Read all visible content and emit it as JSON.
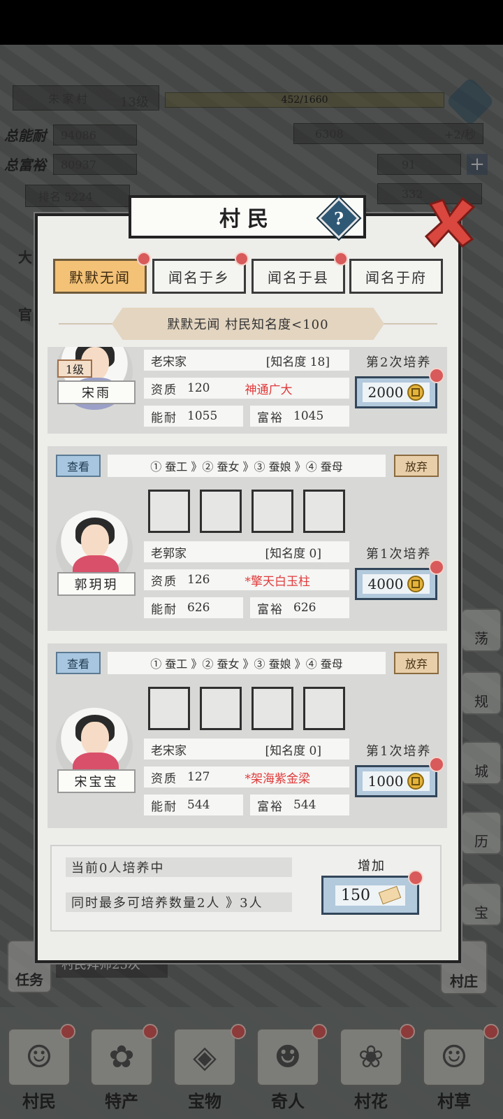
{
  "hud": {
    "village_name": "朱家村",
    "village_level": "13级",
    "exp_text": "452/1660",
    "total_power_label": "总能耐",
    "total_power_value": "94086",
    "total_wealth_label": "总富裕",
    "total_wealth_value": "80937",
    "rank_text": "排名 5224",
    "coins": "6308",
    "coin_rate": "+2/秒",
    "ingots": "91",
    "tickets": "332"
  },
  "panel": {
    "title": "村民",
    "help_label": "?",
    "tabs": [
      {
        "label": "默默无闻",
        "active": true
      },
      {
        "label": "闻名于乡",
        "active": false
      },
      {
        "label": "闻名于县",
        "active": false
      },
      {
        "label": "闻名于府",
        "active": false
      }
    ],
    "banner": "默默无闻   村民知名度<100"
  },
  "villagers": [
    {
      "level": "1级",
      "name": "宋雨",
      "family": "老宋家",
      "fame": "[知名度 18]",
      "aptitude_label": "资质",
      "aptitude_value": "120",
      "aptitude_title": "神通广大",
      "power_label": "能耐",
      "power_value": "1055",
      "wealth_label": "富裕",
      "wealth_value": "1045",
      "train_label": "第2次培养",
      "cost": "2000"
    },
    {
      "view_label": "查看",
      "drop_label": "放弃",
      "path": "① 蚕工 》② 蚕女 》③ 蚕娘 》④ 蚕母",
      "name": "郭玥玥",
      "family": "老郭家",
      "fame": "[知名度 0]",
      "aptitude_label": "资质",
      "aptitude_value": "126",
      "aptitude_title": "*擎天白玉柱",
      "power_label": "能耐",
      "power_value": "626",
      "wealth_label": "富裕",
      "wealth_value": "626",
      "train_label": "第1次培养",
      "cost": "4000"
    },
    {
      "view_label": "查看",
      "drop_label": "放弃",
      "path": "① 蚕工 》② 蚕女 》③ 蚕娘 》④ 蚕母",
      "name": "宋宝宝",
      "family": "老宋家",
      "fame": "[知名度 0]",
      "aptitude_label": "资质",
      "aptitude_value": "127",
      "aptitude_title": "*架海紫金梁",
      "power_label": "能耐",
      "power_value": "544",
      "wealth_label": "富裕",
      "wealth_value": "544",
      "train_label": "第1次培养",
      "cost": "1000"
    }
  ],
  "footer": {
    "current_training": "当前0人培养中",
    "max_training": "同时最多可培养数量2人 》3人",
    "add_label": "增加",
    "add_cost": "150"
  },
  "side": {
    "left_labels": [
      "大",
      "官"
    ],
    "right_labels": [
      "荡",
      "规",
      "城",
      "历",
      "宝"
    ],
    "task_label": "任务",
    "village_label": "村庄",
    "master_strip": "村民拜师25次"
  },
  "bottom_nav": [
    {
      "label": "村民",
      "icon": "villager-icon"
    },
    {
      "label": "特产",
      "icon": "specialty-icon"
    },
    {
      "label": "宝物",
      "icon": "treasure-icon"
    },
    {
      "label": "奇人",
      "icon": "stranger-icon"
    },
    {
      "label": "村花",
      "icon": "village-belle-icon"
    },
    {
      "label": "村草",
      "icon": "village-hunk-icon"
    }
  ]
}
